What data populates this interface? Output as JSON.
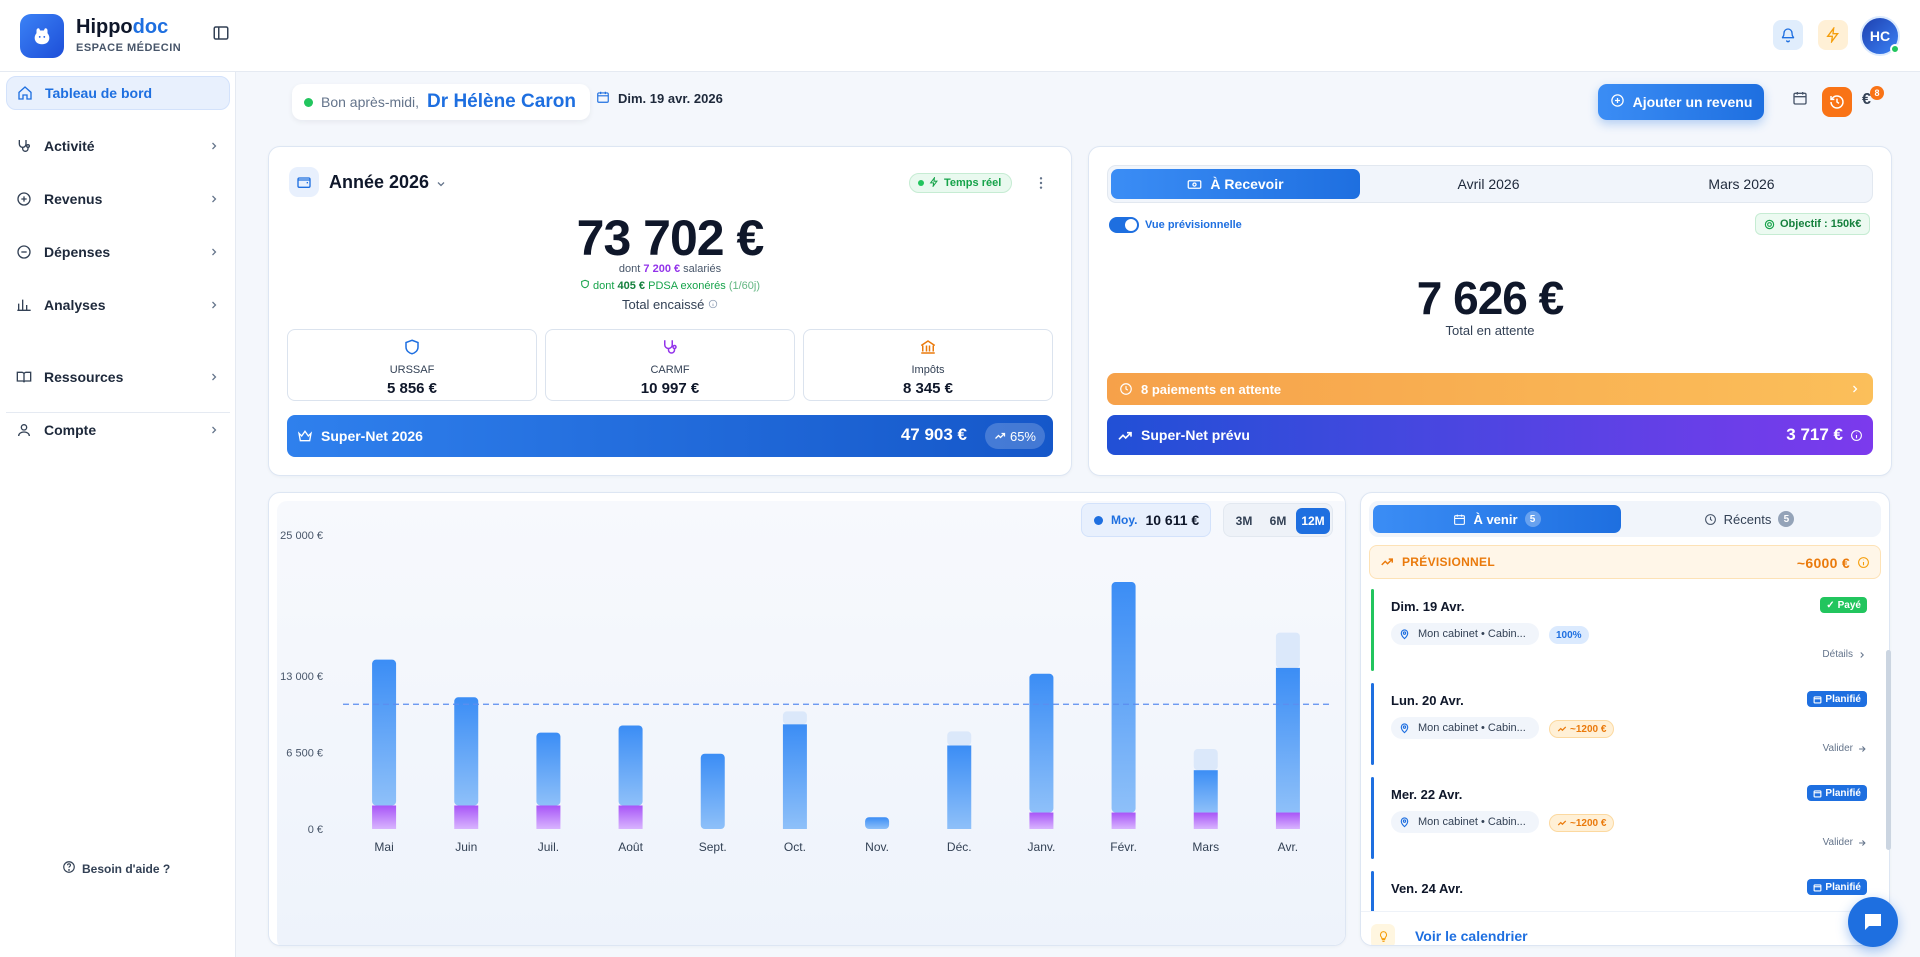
{
  "brand": {
    "name_main": "Hippo",
    "name_accent": "doc",
    "subtitle": "ESPACE MÉDECIN"
  },
  "user": {
    "initials": "HC",
    "greeting": "Bon après-midi,",
    "name": "Dr Hélène Caron"
  },
  "header": {
    "date": "Dim. 19 avr. 2026",
    "add_revenue": "Ajouter un revenu",
    "euro_icon": "€",
    "notif_count": "8"
  },
  "sidebar": {
    "items": [
      {
        "label": "Tableau de bord",
        "icon": "home-icon"
      },
      {
        "label": "Activité",
        "icon": "stethoscope-icon"
      },
      {
        "label": "Revenus",
        "icon": "plus-circle-icon"
      },
      {
        "label": "Dépenses",
        "icon": "minus-circle-icon"
      },
      {
        "label": "Analyses",
        "icon": "bar-chart-icon"
      },
      {
        "label": "Ressources",
        "icon": "book-icon"
      },
      {
        "label": "Compte",
        "icon": "user-icon"
      }
    ],
    "help": "Besoin d'aide ?"
  },
  "year_card": {
    "title": "Année 2026",
    "realtime": "Temps réel",
    "total": "73 702 €",
    "sub_prefix": "dont",
    "salaried_value": "7 200 €",
    "salaried_suffix": "salariés",
    "pdsa_prefix": "dont",
    "pdsa_value": "405 €",
    "pdsa_suffix": "PDSA exonérés",
    "pdsa_days": "(1/60j)",
    "total_label": "Total encaissé",
    "taxes": [
      {
        "label": "URSSAF",
        "value": "5 856 €"
      },
      {
        "label": "CARMF",
        "value": "10 997 €"
      },
      {
        "label": "Impôts",
        "value": "8 345 €"
      }
    ],
    "supernet_label": "Super-Net 2026",
    "supernet_value": "47 903 €",
    "supernet_pct": "65%"
  },
  "receive_card": {
    "tabs": [
      "À Recevoir",
      "Avril 2026",
      "Mars 2026"
    ],
    "toggle_label": "Vue prévisionnelle",
    "objective": "Objectif : 150k€",
    "pending_total": "7 626 €",
    "pending_label": "Total en attente",
    "payments_pending": "8 paiements en attente",
    "supernet_label": "Super-Net prévu",
    "supernet_value": "3 717 €"
  },
  "chart_controls": {
    "avg_label": "Moy.",
    "avg_value": "10 611 €",
    "ranges": [
      "3M",
      "6M",
      "12M"
    ],
    "active_range": "12M"
  },
  "chart_data": {
    "type": "bar",
    "categories": [
      "Mai",
      "Juin",
      "Juil.",
      "Août",
      "Sept.",
      "Oct.",
      "Nov.",
      "Déc.",
      "Janv.",
      "Févr.",
      "Mars",
      "Avr."
    ],
    "series": [
      {
        "values": [
          2000,
          2000,
          2000,
          2000,
          0,
          0,
          0,
          0,
          1400,
          1400,
          1400,
          1400
        ]
      },
      {
        "values": [
          12400,
          9200,
          6200,
          6800,
          6400,
          8900,
          1000,
          7100,
          11800,
          19600,
          3600,
          12300
        ]
      },
      {
        "values": [
          0,
          0,
          0,
          0,
          0,
          1100,
          0,
          1200,
          0,
          0,
          1800,
          3000
        ]
      }
    ],
    "ytick_labels": [
      "0 €",
      "6 500 €",
      "13 000 €",
      "25 000 €"
    ],
    "ytick_values": [
      0,
      6500,
      13000,
      25000
    ],
    "ylim": [
      0,
      25000
    ],
    "average": 10611,
    "colors": {
      "violet": "#a855f7",
      "blue": "#3b8df5",
      "pending": "#dbe8fa",
      "avg_line": "#5b8def"
    }
  },
  "upcoming": {
    "tabs": [
      {
        "label": "À venir",
        "count": "5"
      },
      {
        "label": "Récents",
        "count": "5"
      }
    ],
    "forecast_label": "PRÉVISIONNEL",
    "forecast_value": "~6000 €",
    "events": [
      {
        "date": "Dim. 19 Avr.",
        "status": "Payé",
        "location": "Mon cabinet • Cabin...",
        "amount": "100%",
        "action": "Détails"
      },
      {
        "date": "Lun. 20 Avr.",
        "status": "Planifié",
        "location": "Mon cabinet • Cabin...",
        "amount": "~1200 €",
        "action": "Valider"
      },
      {
        "date": "Mer. 22 Avr.",
        "status": "Planifié",
        "location": "Mon cabinet • Cabin...",
        "amount": "~1200 €",
        "action": "Valider"
      },
      {
        "date": "Ven. 24 Avr.",
        "status": "Planifié"
      }
    ],
    "calendar_link": "Voir le calendrier"
  }
}
